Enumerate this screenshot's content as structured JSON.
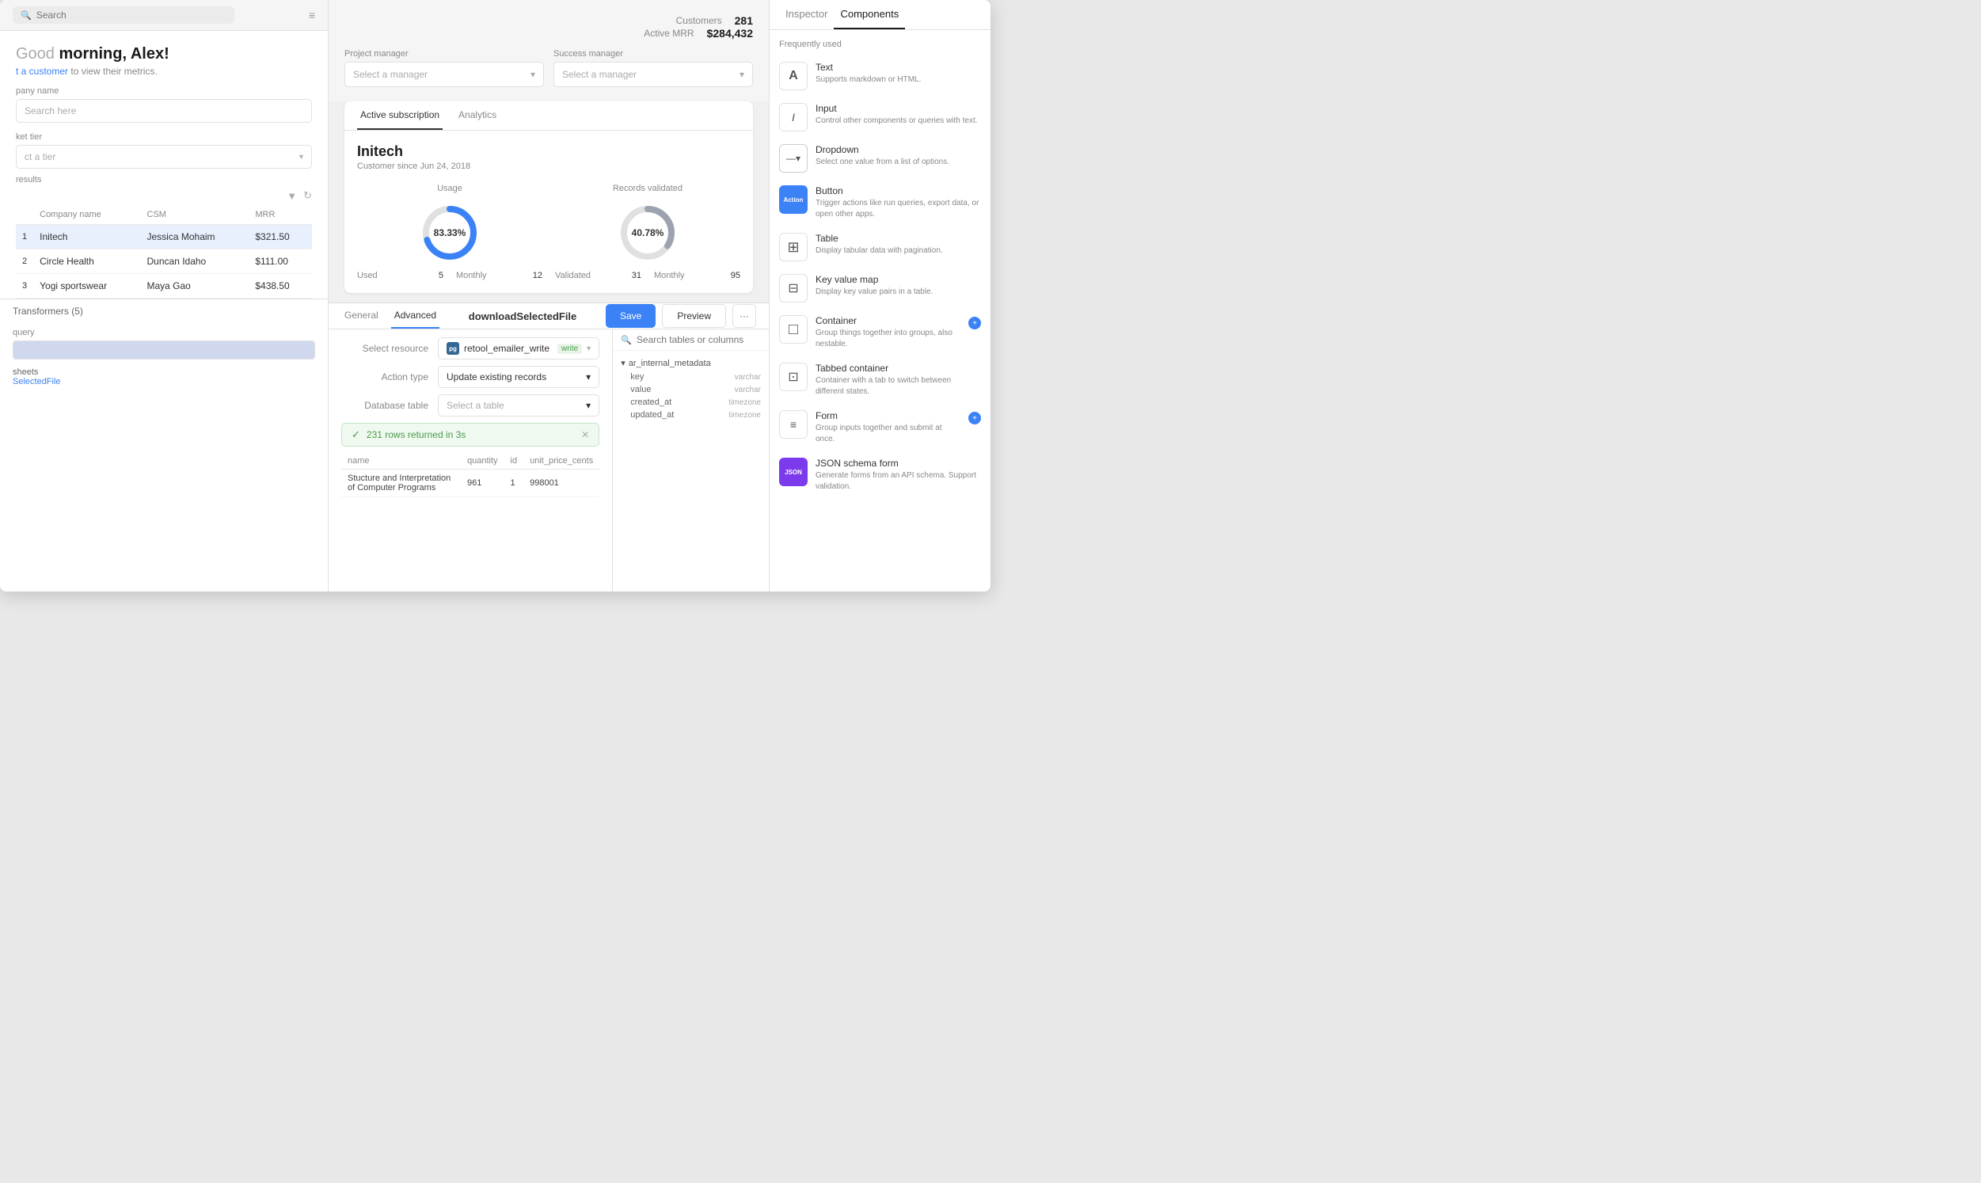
{
  "topbar": {
    "search_placeholder": "Search"
  },
  "greeting": {
    "prefix": "Good",
    "suffix": " morning, Alex!",
    "subtitle_prefix": "t a customer",
    "subtitle_link": " to view their metrics."
  },
  "metrics": {
    "customers_label": "Customers",
    "customers_value": "281",
    "mrr_label": "Active MRR",
    "mrr_value": "$284,432"
  },
  "form": {
    "company_name_label": "pany name",
    "company_name_placeholder": "Search here",
    "market_tier_label": "ket tier",
    "market_tier_placeholder": "ct a tier",
    "project_manager_label": "Project manager",
    "project_manager_placeholder": "Select a manager",
    "success_manager_label": "Success manager",
    "success_manager_placeholder": "Select a manager"
  },
  "table": {
    "results_label": "results",
    "columns": [
      "Company name",
      "CSM",
      "MRR"
    ],
    "rows": [
      {
        "num": "1",
        "company": "Initech",
        "csm": "Jessica Mohaim",
        "mrr": "$321.50",
        "highlighted": true
      },
      {
        "num": "2",
        "company": "Circle Health",
        "csm": "Duncan Idaho",
        "mrr": "$111.00",
        "highlighted": false
      },
      {
        "num": "3",
        "company": "Yogi sportswear",
        "csm": "Maya Gao",
        "mrr": "$438.50",
        "highlighted": false
      }
    ]
  },
  "left_bottom": {
    "transformers_label": "Transformers (5)",
    "query_label": "query",
    "sheets_label": "sheets",
    "file_label": "SelectedFile"
  },
  "bottom_panel": {
    "tabs": [
      "General",
      "Advanced"
    ],
    "active_tab": "Advanced",
    "title": "downloadSelectedFile",
    "resource_label": "Select resource",
    "resource_type": "postgresql",
    "resource_name": "retool_emailer_write",
    "resource_tag": "write",
    "action_type_label": "Action type",
    "action_type_value": "Update existing records",
    "database_table_label": "Database table",
    "database_table_placeholder": "Select a table",
    "success_message": "231 rows returned in 3s",
    "table_columns": [
      "name",
      "quantity",
      "id",
      "unit_price_cents"
    ],
    "table_rows": [
      {
        "name": "Stucture and Interpretation of Computer Programs",
        "quantity": "961",
        "id": "1",
        "unit_price_cents": "998001"
      }
    ]
  },
  "customer_card": {
    "tabs": [
      "Active subscription",
      "Analytics"
    ],
    "active_tab": "Active subscription",
    "name": "Initech",
    "since": "Customer since Jun 24, 2018",
    "usage": {
      "title": "Usage",
      "percentage": "83.33%",
      "used_label": "Used",
      "used_value": "5",
      "monthly_label": "Monthly",
      "monthly_value": "12"
    },
    "validated": {
      "title": "Records validated",
      "percentage": "40.78%",
      "validated_label": "Validated",
      "validated_value": "31",
      "monthly_label": "Monthly",
      "monthly_value": "95"
    }
  },
  "action_buttons": {
    "save": "Save",
    "preview": "Preview",
    "more": "···"
  },
  "db_panel": {
    "search_placeholder": "Search tables or columns",
    "tree": {
      "parent": "ar_internal_metadata",
      "children": [
        {
          "name": "key",
          "type": "varchar"
        },
        {
          "name": "value",
          "type": "varchar"
        },
        {
          "name": "created_at",
          "type": "timezone"
        },
        {
          "name": "updated_at",
          "type": "timezone"
        }
      ]
    }
  },
  "right_sidebar": {
    "tabs": [
      "Inspector",
      "Components"
    ],
    "active_tab": "Components",
    "frequently_used_label": "Frequently used",
    "components": [
      {
        "name": "Text",
        "desc": "Supports markdown or HTML.",
        "icon": "A",
        "icon_type": "text"
      },
      {
        "name": "Input",
        "desc": "Control other components or queries with text.",
        "icon": "I",
        "icon_type": "input"
      },
      {
        "name": "Dropdown",
        "desc": "Select one value from a list of options.",
        "icon": "▾",
        "icon_type": "dropdown"
      },
      {
        "name": "Button",
        "desc": "Trigger actions like run queries, export data, or open other apps.",
        "icon": "Action",
        "icon_type": "button"
      },
      {
        "name": "Table",
        "desc": "Display tabular data with pagination.",
        "icon": "⊞",
        "icon_type": "table"
      },
      {
        "name": "Key value map",
        "desc": "Display key value pairs in a table.",
        "icon": "⊟",
        "icon_type": "keyvalue"
      },
      {
        "name": "Container",
        "desc": "Group things together into groups, also nestable.",
        "icon": "□",
        "icon_type": "container",
        "has_add": true
      },
      {
        "name": "Tabbed container",
        "desc": "Container with a tab to switch between different states.",
        "icon": "⊡",
        "icon_type": "tabbed"
      },
      {
        "name": "Form",
        "desc": "Group inputs together and submit at once.",
        "icon": "≡",
        "icon_type": "form",
        "has_add": true
      },
      {
        "name": "JSON schema form",
        "desc": "Generate forms from an API schema. Support validation.",
        "icon": "JSON",
        "icon_type": "json"
      }
    ]
  }
}
